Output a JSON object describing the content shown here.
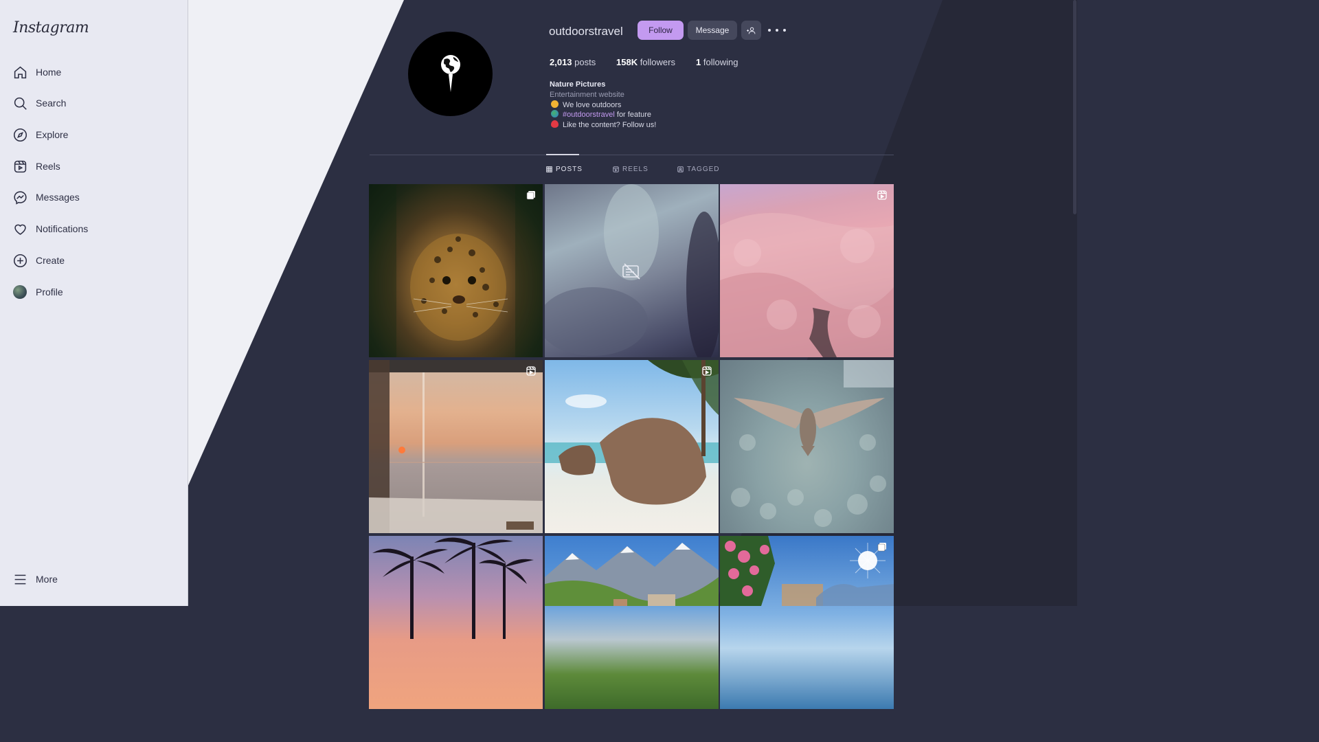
{
  "sidebar": {
    "logo": "Instagram",
    "items": [
      {
        "label": "Home",
        "icon": "home-icon"
      },
      {
        "label": "Search",
        "icon": "search-icon"
      },
      {
        "label": "Explore",
        "icon": "compass-icon"
      },
      {
        "label": "Reels",
        "icon": "reels-icon"
      },
      {
        "label": "Messages",
        "icon": "messenger-icon"
      },
      {
        "label": "Notifications",
        "icon": "heart-icon"
      },
      {
        "label": "Create",
        "icon": "plus-square-icon"
      },
      {
        "label": "Profile",
        "icon": "avatar"
      }
    ],
    "more_label": "More"
  },
  "profile": {
    "username": "outdoorstravel",
    "follow_label": "Follow",
    "message_label": "Message",
    "stats": {
      "posts_count": "2,013",
      "posts_label": " posts",
      "followers_count": "158K",
      "followers_label": " followers",
      "following_count": "1",
      "following_label": " following"
    },
    "bio": {
      "name": "Nature Pictures",
      "category": "Entertainment website",
      "line1": "We love outdoors",
      "hashtag": "#outdoorstravel",
      "line2_suffix": " for feature",
      "line3": "Like the content? Follow us!"
    }
  },
  "tabs": [
    {
      "label": "POSTS",
      "active": true
    },
    {
      "label": "REELS",
      "active": false
    },
    {
      "label": "TAGGED",
      "active": false
    }
  ],
  "posts": [
    {
      "subject": "leopard",
      "badge": "carousel"
    },
    {
      "subject": "blurred-unavailable",
      "badge": "none"
    },
    {
      "subject": "pink-forest",
      "badge": "reel"
    },
    {
      "subject": "sunset-window",
      "badge": "reel"
    },
    {
      "subject": "beach-rocks",
      "badge": "reel"
    },
    {
      "subject": "eagle-over-forest",
      "badge": "none"
    },
    {
      "subject": "palm-sunset",
      "badge": "none"
    },
    {
      "subject": "mountain-village",
      "badge": "none"
    },
    {
      "subject": "flowers-lake",
      "badge": "carousel"
    }
  ],
  "colors": {
    "accent": "#c39af0",
    "background": "#2c2f42",
    "sidebar": "#e8e9f2"
  }
}
